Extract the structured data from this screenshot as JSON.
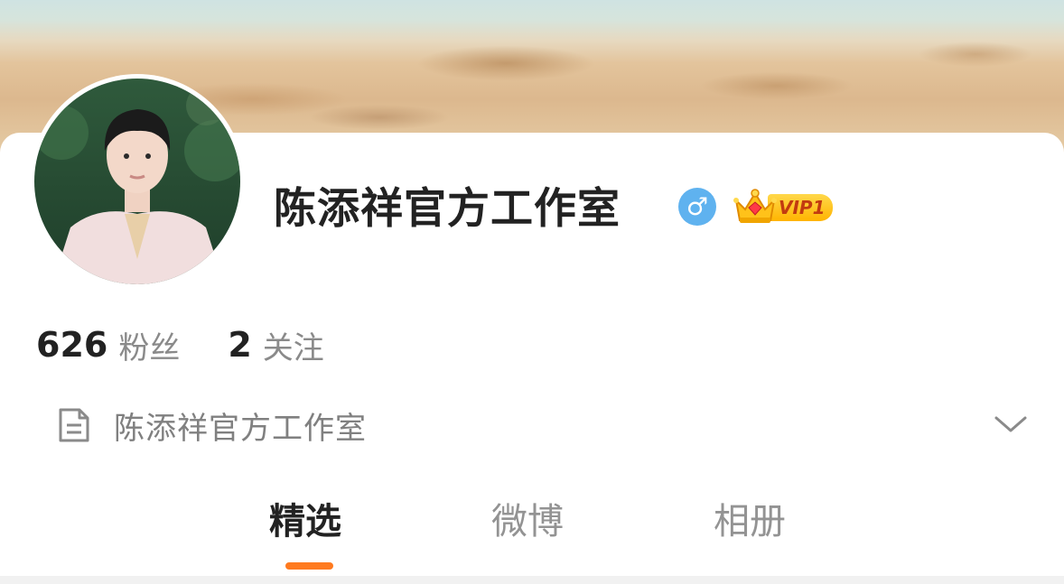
{
  "profile": {
    "name": "陈添祥官方工作室",
    "gender_icon": "male-icon",
    "vip_label": "VIP1",
    "avatar_icon": "avatar",
    "bio": "陈添祥官方工作室"
  },
  "stats": {
    "followers_count": "626",
    "followers_label": "粉丝",
    "following_count": "2",
    "following_label": "关注"
  },
  "tabs": [
    {
      "label": "精选",
      "active": true
    },
    {
      "label": "微博",
      "active": false
    },
    {
      "label": "相册",
      "active": false
    }
  ],
  "colors": {
    "accent": "#ff7a1f",
    "gender_badge": "#5fb2ef",
    "vip_gold": "#ffc21a"
  }
}
